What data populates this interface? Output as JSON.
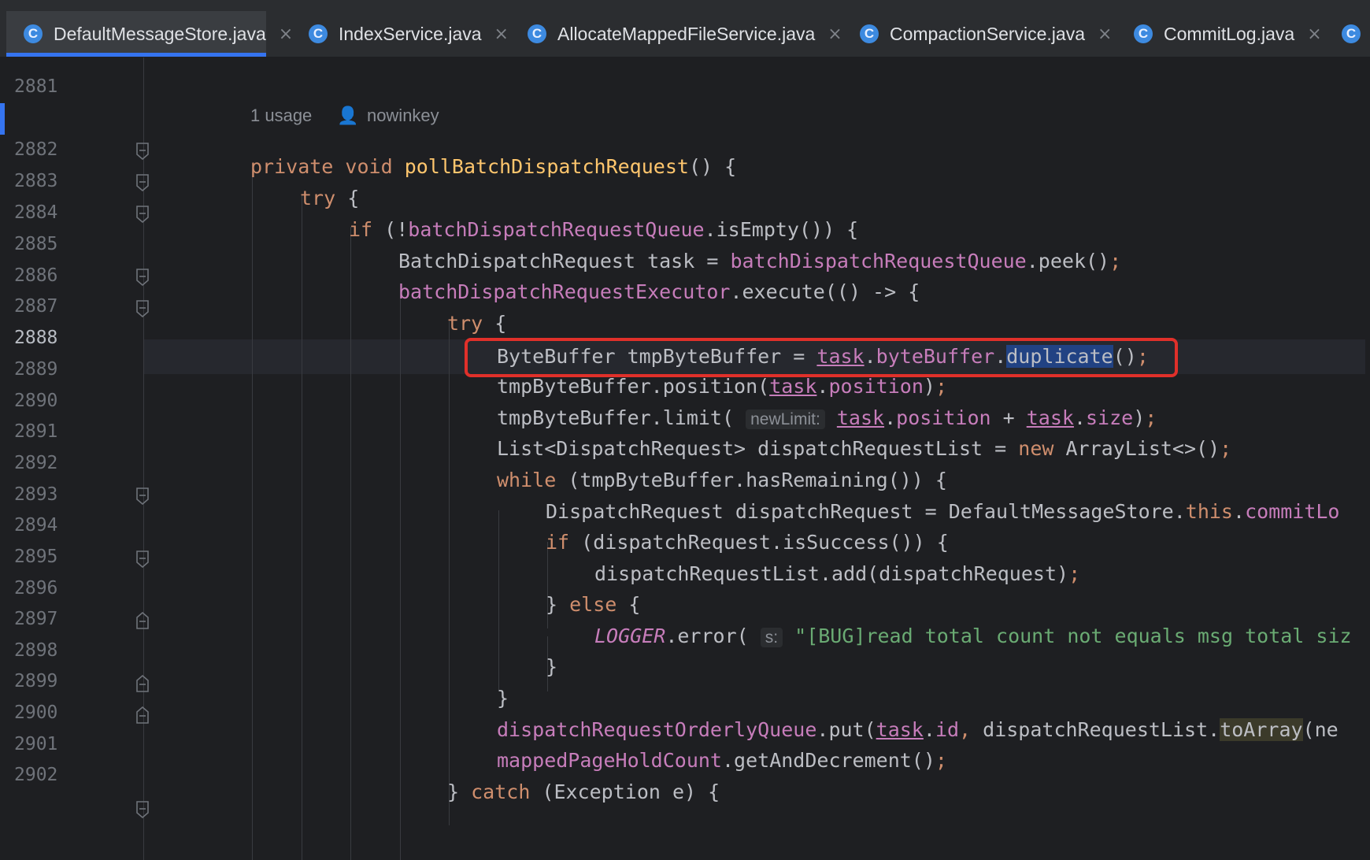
{
  "tabs": [
    {
      "label": "DefaultMessageStore.java",
      "icon": "C",
      "active": true
    },
    {
      "label": "IndexService.java",
      "icon": "C",
      "active": false
    },
    {
      "label": "AllocateMappedFileService.java",
      "icon": "C",
      "active": false
    },
    {
      "label": "CompactionService.java",
      "icon": "C",
      "active": false
    },
    {
      "label": "CommitLog.java",
      "icon": "C",
      "active": false
    }
  ],
  "tab_close_glyph": "×",
  "meta": {
    "usages": "1 usage",
    "author": "nowinkey"
  },
  "lines": [
    "2881",
    "2882",
    "2883",
    "2884",
    "2885",
    "2886",
    "2887",
    "2888",
    "2889",
    "2890",
    "2891",
    "2892",
    "2893",
    "2894",
    "2895",
    "2896",
    "2897",
    "2898",
    "2899",
    "2900",
    "2901",
    "2902"
  ],
  "current_line": "2888",
  "code": {
    "l2882": {
      "kw1": "private",
      "kw2": "void",
      "fn": "pollBatchDispatchRequest",
      "rest": "() {"
    },
    "l2883": {
      "kw": "try",
      "rest": " {"
    },
    "l2884": {
      "kw": "if",
      "p1": " (!",
      "fld": "batchDispatchRequestQueue",
      "rest": ".isEmpty()) {"
    },
    "l2885": {
      "t1": "BatchDispatchRequest task = ",
      "fld": "batchDispatchRequestQueue",
      "rest": ".peek()",
      "semi": ";"
    },
    "l2886": {
      "fld": "batchDispatchRequestExecutor",
      "rest": ".execute(() -> {"
    },
    "l2887": {
      "kw": "try",
      "rest": " {"
    },
    "l2888": {
      "t1": "ByteBuffer tmpByteBuffer = ",
      "task": "task",
      "dot1": ".",
      "fld": "byteBuffer",
      "dot2": ".",
      "sel": "duplicate",
      "rest": "()",
      "semi": ";"
    },
    "l2889": {
      "t1": "tmpByteBuffer.position(",
      "task": "task",
      "dot": ".",
      "fld": "position",
      "rest": ")",
      "semi": ";"
    },
    "l2890": {
      "t1": "tmpByteBuffer.limit(",
      "hint": "newLimit:",
      "task1": "task",
      "dot1": ".",
      "fld1": "position",
      "plus": " + ",
      "task2": "task",
      "dot2": ".",
      "fld2": "size",
      "rest": ")",
      "semi": ";"
    },
    "l2891": {
      "t1": "List<DispatchRequest> dispatchRequestList = ",
      "kw": "new",
      "rest": " ArrayList<>()",
      "semi": ";"
    },
    "l2892": {
      "kw": "while",
      "rest": " (tmpByteBuffer.hasRemaining()) {"
    },
    "l2893": {
      "t1": "DispatchRequest dispatchRequest = DefaultMessageStore.",
      "kw": "this",
      "dot": ".",
      "fld": "commitLo"
    },
    "l2894": {
      "kw": "if",
      "rest": " (dispatchRequest.isSuccess()) {"
    },
    "l2895": {
      "t1": "dispatchRequestList.add(dispatchRequest)",
      "semi": ";"
    },
    "l2896": {
      "t1": "} ",
      "kw": "else",
      "rest": " {"
    },
    "l2897": {
      "fld": "LOGGER",
      "t1": ".error(",
      "hint": "s:",
      "str": "\"[BUG]read total count not equals msg total siz"
    },
    "l2898": {
      "t1": "}"
    },
    "l2899": {
      "t1": "}"
    },
    "l2900": {
      "fld": "dispatchRequestOrderlyQueue",
      "t1": ".put(",
      "task": "task",
      "dot": ".",
      "fld2": "id",
      "comma": ", ",
      "t2": "dispatchRequestList.",
      "fn": "toArray",
      "rest": "(ne"
    },
    "l2901": {
      "fld": "mappedPageHoldCount",
      "rest": ".getAndDecrement()",
      "semi": ";"
    },
    "l2902": {
      "t1": "} ",
      "kw": "catch",
      "rest": " (Exception e) {"
    }
  },
  "colors": {
    "keyword": "#cf8e6d",
    "field": "#c77dbb",
    "string": "#6aab73",
    "highlight_box": "#e0302a",
    "selection": "#214283"
  }
}
